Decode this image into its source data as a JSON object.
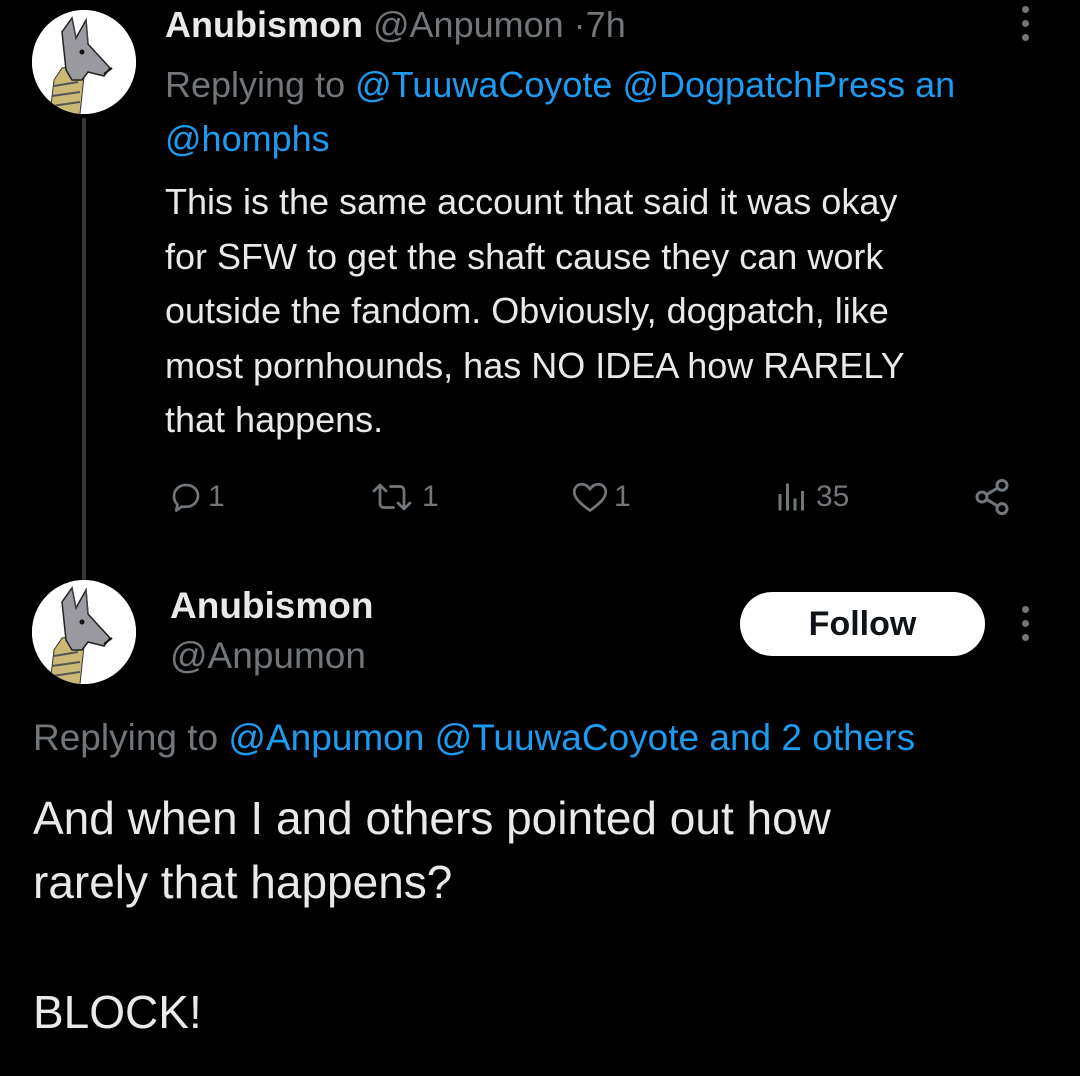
{
  "tweet1": {
    "display_name": "Anubismon",
    "handle": "@Anpumon",
    "separator": "·",
    "time": "7h",
    "reply_prefix": "Replying to",
    "reply_mention_1": "@TuuwaCoyote",
    "reply_mention_2": "@DogpatchPress an",
    "reply_mention_3": "@homphs",
    "body_lines": [
      "This is the same account that said it was okay",
      "for SFW to get the shaft cause they can work",
      "outside the fandom. Obviously, dogpatch, like",
      "most pornhounds, has NO IDEA how RARELY",
      "that happens."
    ],
    "actions": {
      "reply_count": "1",
      "repost_count": "1",
      "like_count": "1",
      "view_count": "35"
    }
  },
  "tweet2": {
    "display_name": "Anubismon",
    "handle": "@Anpumon",
    "follow_label": "Follow",
    "reply_prefix": "Replying to",
    "reply_mentions": "@Anpumon @TuuwaCoyote and 2 others",
    "body_lines": [
      "And when I and others pointed out how",
      "rarely that happens?"
    ],
    "body_last": "BLOCK!"
  },
  "icons": {
    "reply": "speech-bubble-icon",
    "repost": "repost-arrows-icon",
    "like": "heart-icon",
    "views": "bar-chart-icon",
    "share": "share-nodes-icon",
    "more": "vertical-dots-icon"
  },
  "colors": {
    "background": "#000000",
    "text": "#e7e9ea",
    "muted": "#71767b",
    "link": "#1d9bf0",
    "follow_bg": "#ffffff"
  }
}
